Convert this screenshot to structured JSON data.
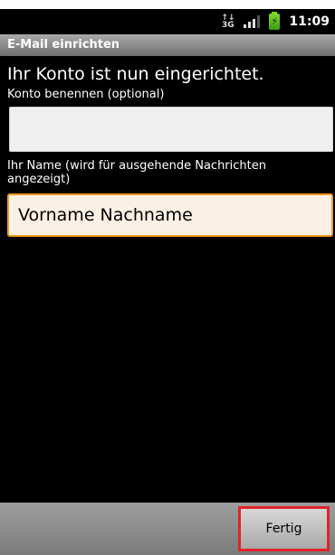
{
  "status_bar": {
    "network_label": "3G",
    "time": "11:09",
    "battery_color": "#6ccc22"
  },
  "title_bar": {
    "title": "E-Mail einrichten"
  },
  "form": {
    "heading": "Ihr Konto ist nun eingerichtet.",
    "account_name_label": "Konto benennen (optional)",
    "account_name_value": "",
    "your_name_label": "Ihr Name (wird für ausgehende Nachrichten angezeigt)",
    "your_name_value": "Vorname Nachname",
    "focus_color": "#f39a1e"
  },
  "bottom_bar": {
    "done_label": "Fertig"
  }
}
